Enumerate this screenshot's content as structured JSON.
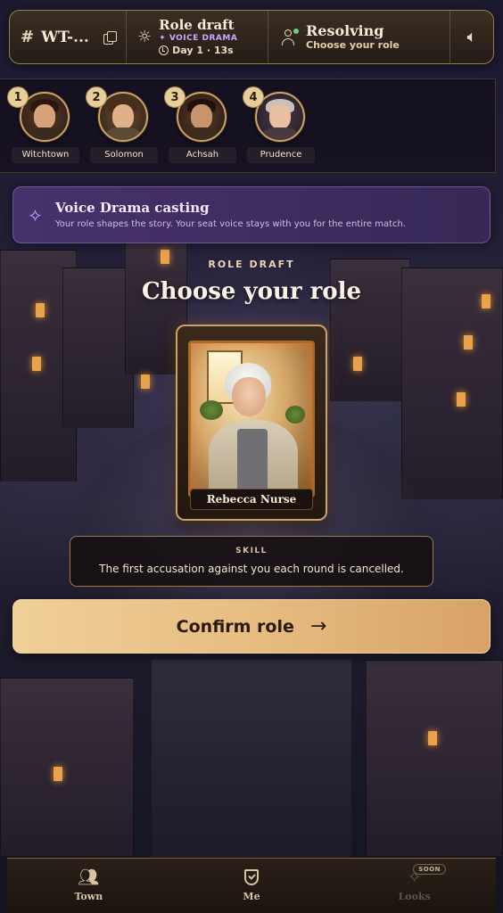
{
  "topbar": {
    "room_code": "WT-...",
    "phase_title": "Role draft",
    "phase_mode": "VOICE DRAMA",
    "phase_time": "Day 1 · 13s",
    "status_title": "Resolving",
    "status_sub": "Choose your role"
  },
  "players": [
    {
      "seat": "1",
      "name": "Witchtown"
    },
    {
      "seat": "2",
      "name": "Solomon"
    },
    {
      "seat": "3",
      "name": "Achsah"
    },
    {
      "seat": "4",
      "name": "Prudence"
    }
  ],
  "banner": {
    "title": "Voice Drama casting",
    "subtitle": "Your role shapes the story. Your seat voice stays with you for the entire match."
  },
  "draft": {
    "eyebrow": "ROLE DRAFT",
    "headline": "Choose your role",
    "role_name": "Rebecca Nurse",
    "skill_label": "SKILL",
    "skill_text": "The first accusation against you each round is cancelled.",
    "confirm_label": "Confirm role"
  },
  "nav": {
    "town": "Town",
    "me": "Me",
    "looks": "Looks",
    "soon": "SOON"
  },
  "colors": {
    "accent_gold": "#c9a36a",
    "confirm_button": "#e7bd82",
    "banner_purple": "#4a3470",
    "online_dot": "#6fcf8a"
  }
}
